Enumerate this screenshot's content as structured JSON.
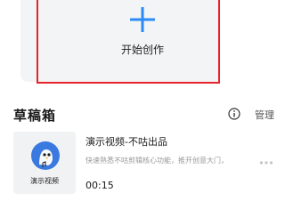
{
  "create": {
    "label": "开始创作",
    "icon": "plus-icon",
    "accent_color": "#2b8bf4"
  },
  "drafts": {
    "title": "草稿箱",
    "info_icon": "info-icon",
    "manage_label": "管理",
    "items": [
      {
        "title": "演示视频-不咕出品",
        "description": "快速熟悉不咕剪辑核心功能，推开创意大门，",
        "duration": "00:15",
        "thumbnail_caption": "演示视频",
        "thumbnail_icon": "bird-avatar-icon",
        "more_icon": "more-icon"
      }
    ]
  },
  "colors": {
    "highlight": "#e5232a",
    "card_bg": "#f3f4f5"
  }
}
